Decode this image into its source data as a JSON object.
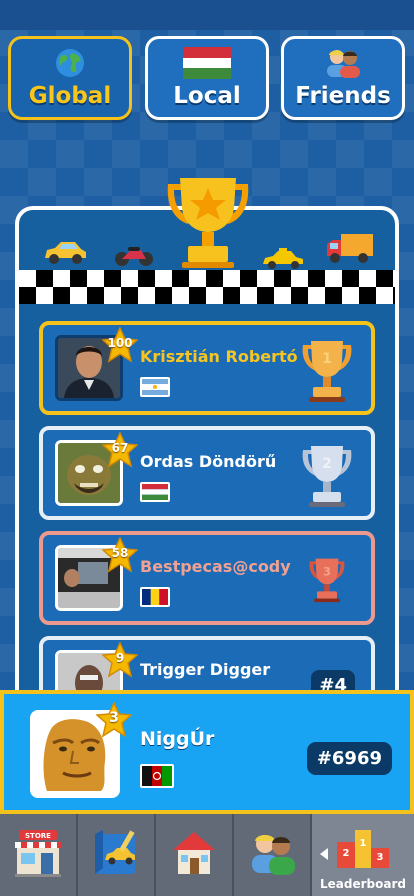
{
  "tabs": [
    {
      "label": "Global",
      "active": true,
      "icon": "globe-icon"
    },
    {
      "label": "Local",
      "active": false,
      "icon": "flag-hungary-icon"
    },
    {
      "label": "Friends",
      "active": false,
      "icon": "friends-icon"
    }
  ],
  "leaderboard": [
    {
      "name": "Krisztián Robertó",
      "level": "100",
      "flag": "argentina",
      "trophy": "1"
    },
    {
      "name": "Ordas Döndörű",
      "level": "67",
      "flag": "hungary",
      "trophy": "2"
    },
    {
      "name": "Bestpecas@cody",
      "level": "58",
      "flag": "romania",
      "trophy": "3"
    },
    {
      "name": "Trigger Digger",
      "level": "9",
      "flag": "",
      "rank": "#4"
    }
  ],
  "me": {
    "name": "NiggÚr",
    "level": "3",
    "flag": "afghanistan",
    "rank": "#6969"
  },
  "nav": {
    "store_label": "STORE",
    "leaderboard_label": "Leaderboard",
    "podium": {
      "first": "1",
      "second": "2",
      "third": "3"
    }
  },
  "colors": {
    "accent": "#f4c21b",
    "background": "#1d5fa2",
    "me_bar": "#18a4f2",
    "nav": "#5d6470"
  }
}
